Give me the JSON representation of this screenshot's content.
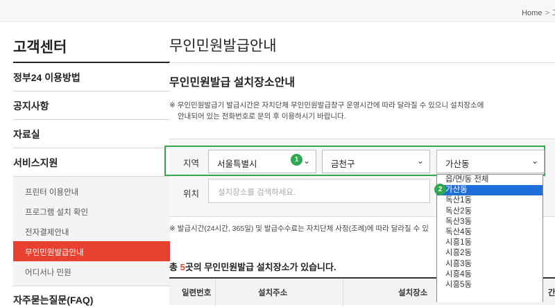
{
  "breadcrumb": {
    "home": "Home",
    "sep": ">",
    "next": "고"
  },
  "sidebar": {
    "title": "고객센터",
    "items": [
      "정부24 이용방법",
      "공지사항",
      "자료실",
      "서비스지원"
    ],
    "subitems": [
      "프린터 이용안내",
      "프로그램 설치 확인",
      "전자결제안내",
      "무인민원발급안내",
      "어디서나 민원"
    ],
    "faq": "자주묻는질문(FAQ)"
  },
  "main": {
    "page_title": "무인민원발급안내",
    "section_title": "무인민원발급 설치장소안내",
    "notice_line1": "※ 무인민원발급기 발급시간은 자치단체 무인민원발급창구 운영시간에 따라 달라질 수 있으니 설치장소에",
    "notice_line2": "안내되어 있는 전화번호로 문의 후 이용하시기 바랍니다.",
    "region_label": "지역",
    "city": "서울특별시",
    "district": "금천구",
    "dong": "가산동",
    "location_label": "위치",
    "location_placeholder": "설치장소를 검색하세요.",
    "note2": "※ 발급시간(24시간, 365일) 및 발급수수료는 자치단체 사정(조례)에 따라 달라질 수 있",
    "count_prefix": "총 ",
    "count_num": "5",
    "count_suffix": "곳의 무인민원발급 설치장소가 있습니다.",
    "table_headers": [
      "일련번호",
      "설치주소",
      "설치장소",
      "간"
    ]
  },
  "badges": {
    "one": "1",
    "two": "2"
  },
  "icons": {
    "chevron": "chevron-down-icon"
  },
  "dropdown_options": [
    "읍/면/동 전체",
    "가산동",
    "독산1동",
    "독산2동",
    "독산3동",
    "독산4동",
    "시흥1동",
    "시흥2동",
    "시흥3동",
    "시흥4동",
    "시흥5동"
  ],
  "dropdown_selected_index": 1,
  "colors": {
    "accent": "#e8412f",
    "highlight": "#2fa84f",
    "selection": "#1e6fd9"
  }
}
